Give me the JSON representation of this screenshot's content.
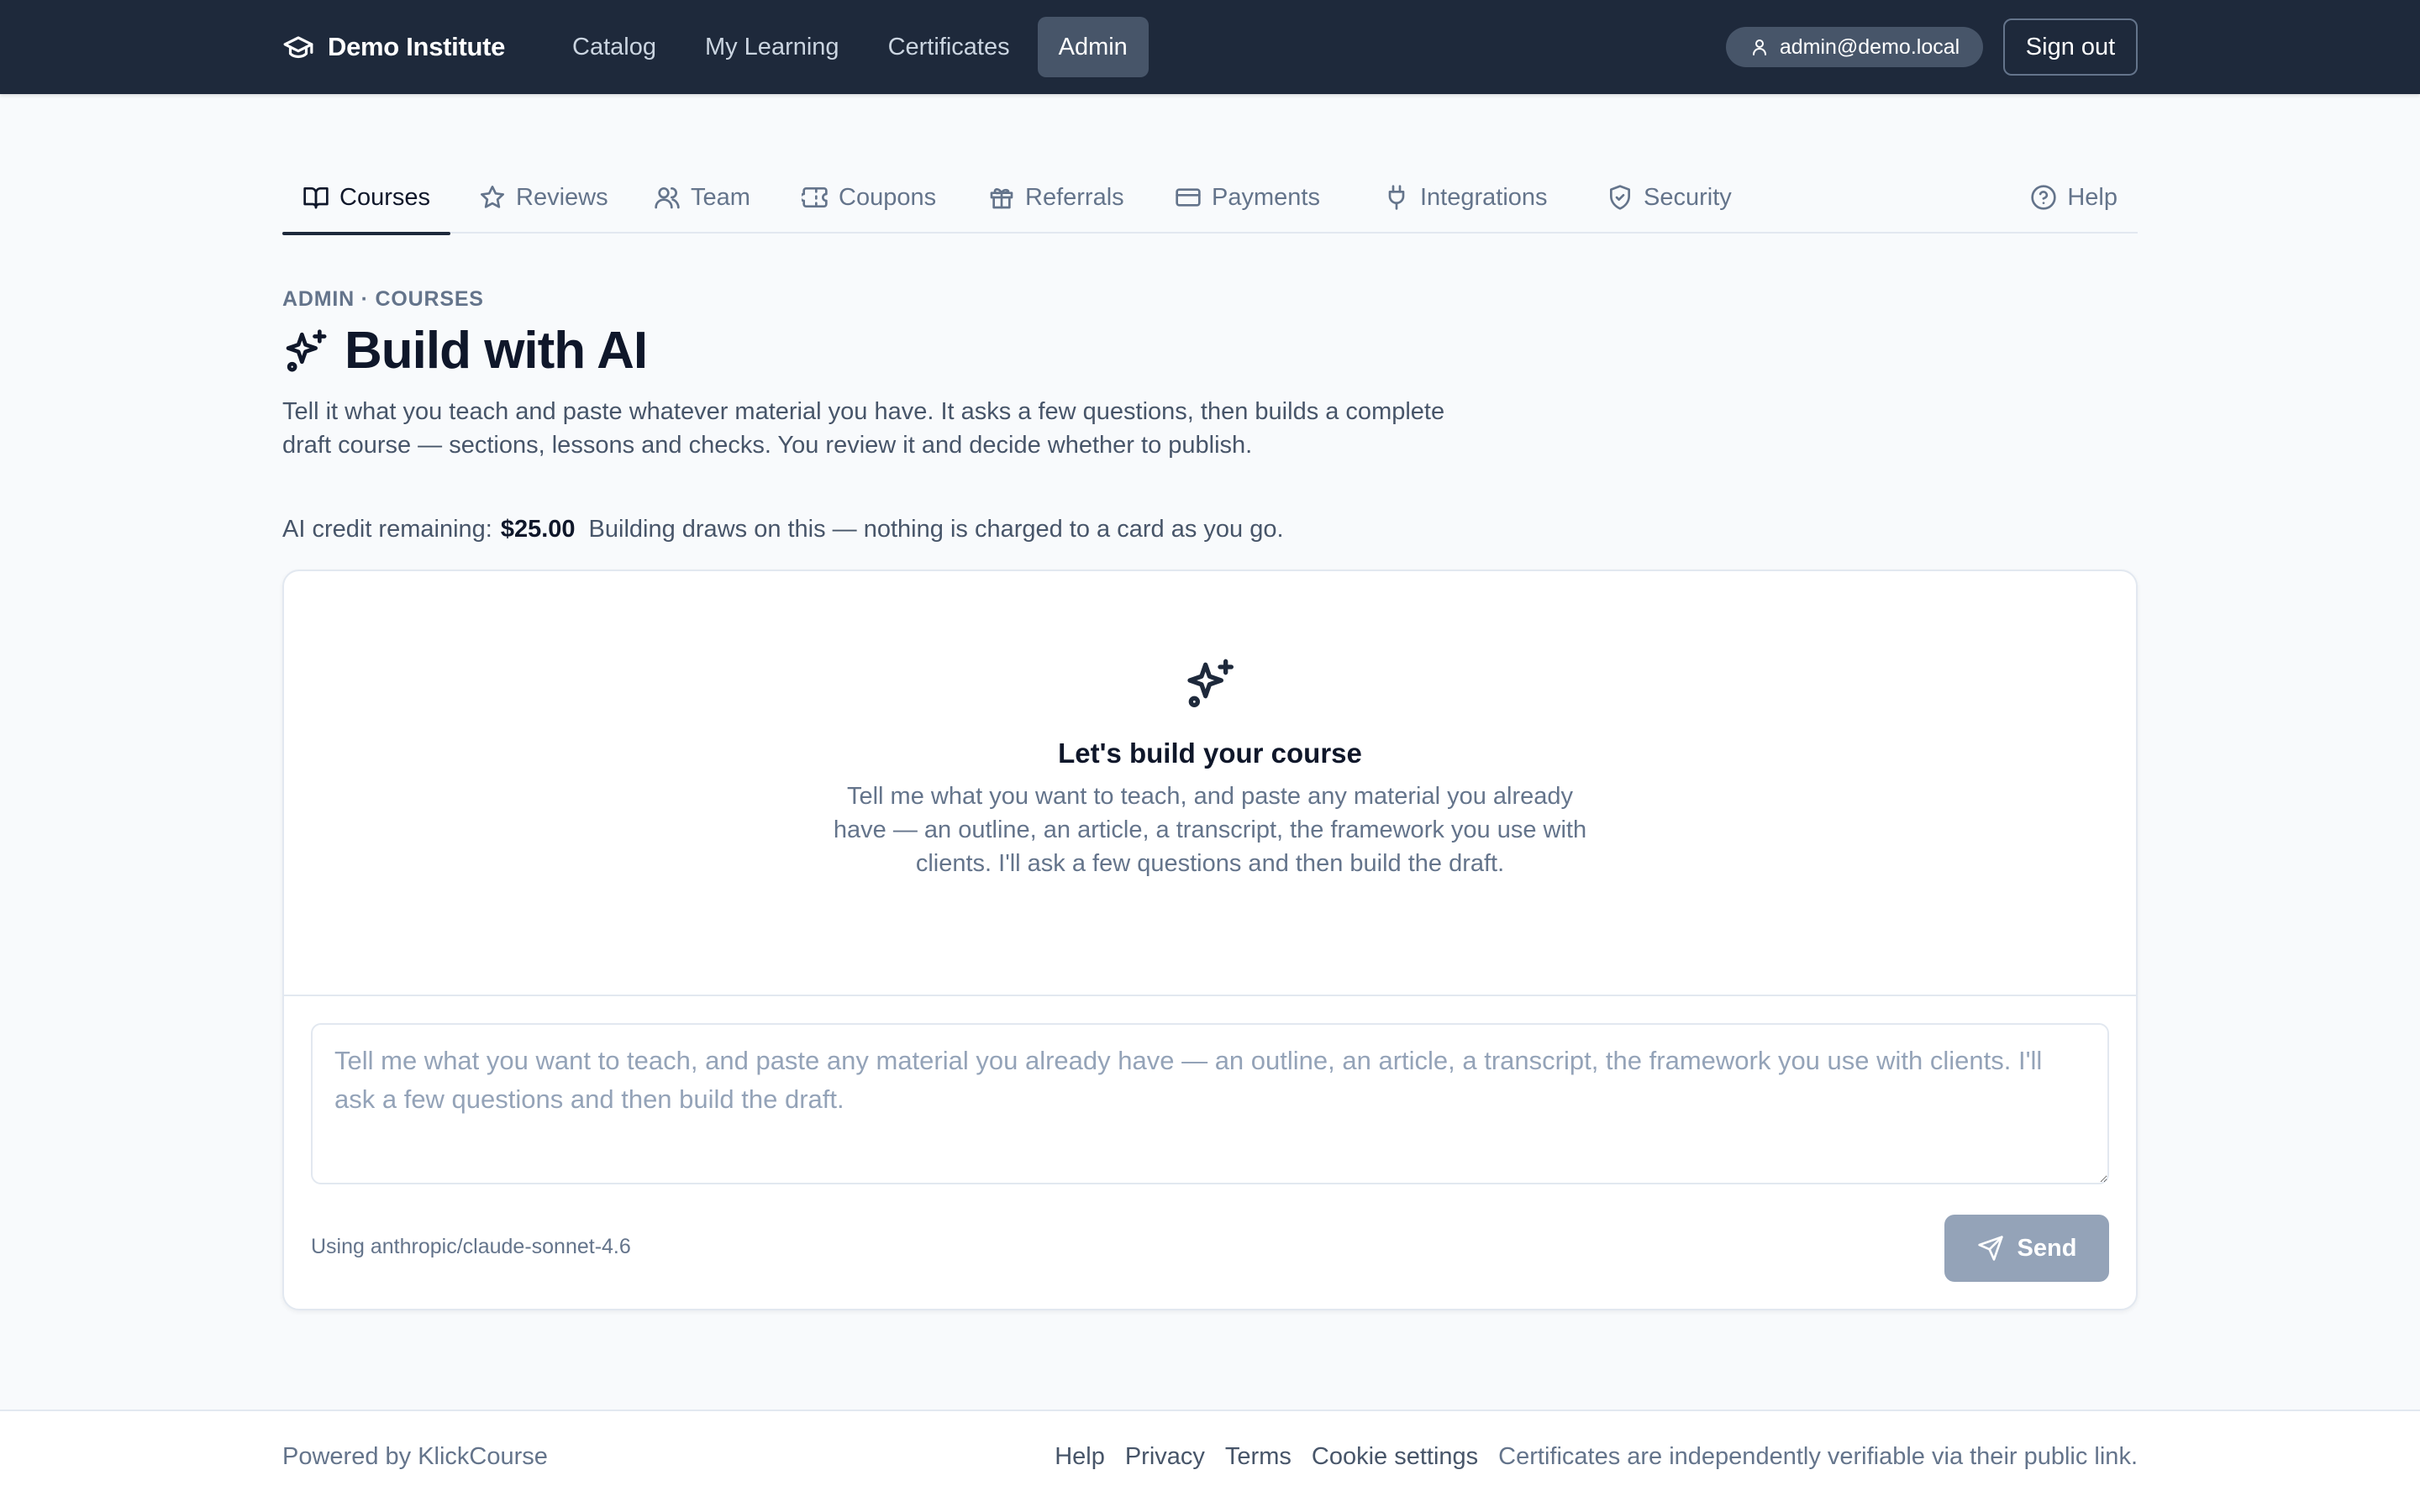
{
  "topbar": {
    "brand": "Demo Institute",
    "nav": [
      "Catalog",
      "My Learning",
      "Certificates",
      "Admin"
    ],
    "active_nav": "Admin",
    "user_email": "admin@demo.local",
    "sign_out": "Sign out"
  },
  "tabs": {
    "courses": "Courses",
    "reviews": "Reviews",
    "team": "Team",
    "coupons": "Coupons",
    "referrals": "Referrals",
    "payments": "Payments",
    "integrations": "Integrations",
    "security": "Security",
    "help": "Help",
    "active": "Courses"
  },
  "page": {
    "breadcrumb": "ADMIN · COURSES",
    "title": "Build with AI",
    "description": "Tell it what you teach and paste whatever material you have. It asks a few questions, then builds a complete draft course — sections, lessons and checks. You review it and decide whether to publish.",
    "credit_label": "AI credit remaining:",
    "credit_amount": "$25.00",
    "credit_note": "Building draws on this — nothing is charged to a card as you go."
  },
  "builder": {
    "empty_title": "Let's build your course",
    "empty_body": "Tell me what you want to teach, and paste any material you already have — an outline, an article, a transcript, the framework you use with clients. I'll ask a few questions and then build the draft.",
    "input_value": "",
    "input_placeholder": "Tell me what you want to teach, and paste any material you already have — an outline, an article, a transcript, the framework you use with clients. I'll ask a few questions and then build the draft.",
    "model_note": "Using anthropic/claude-sonnet-4.6",
    "send_label": "Send",
    "send_enabled": false
  },
  "footer": {
    "powered": "Powered by KlickCourse",
    "help": "Help",
    "privacy": "Privacy",
    "terms": "Terms",
    "cookie_settings": "Cookie settings",
    "certificates_note": "Certificates are independently verifiable via their public link."
  },
  "colors": {
    "topbar_bg": "#1e293b",
    "active_nav_bg": "#475569",
    "page_bg": "#f8fafc",
    "send_disabled_bg": "#94a3b8",
    "text_primary": "#0f172a",
    "text_muted": "#64748b"
  },
  "icons": {
    "brand": "graduation-cap-icon",
    "user": "user-icon",
    "courses": "book-open-icon",
    "reviews": "star-icon",
    "team": "users-icon",
    "coupons": "ticket-icon",
    "referrals": "gift-icon",
    "payments": "credit-card-icon",
    "integrations": "plug-icon",
    "security": "shield-check-icon",
    "help": "help-circle-icon",
    "title": "sparkles-icon",
    "send": "send-icon"
  }
}
